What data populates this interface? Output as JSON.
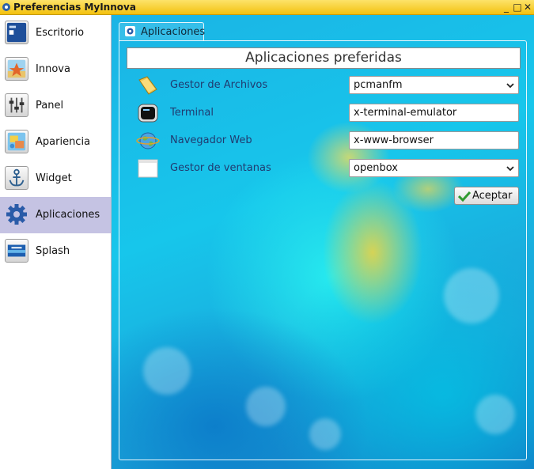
{
  "window": {
    "title": "Preferencias MyInnova",
    "controls": {
      "minimize": "_",
      "maximize": "□",
      "close": "✕"
    }
  },
  "sidebar": {
    "items": [
      {
        "label": "Escritorio",
        "icon": "desktop-icon"
      },
      {
        "label": "Innova",
        "icon": "innova-icon"
      },
      {
        "label": "Panel",
        "icon": "sliders-icon"
      },
      {
        "label": "Apariencia",
        "icon": "appearance-icon"
      },
      {
        "label": "Widget",
        "icon": "anchor-icon"
      },
      {
        "label": "Aplicaciones",
        "icon": "gear-icon",
        "selected": true
      },
      {
        "label": "Splash",
        "icon": "splash-icon"
      }
    ],
    "selected_color": "#c5c3e3"
  },
  "tab": {
    "label": "Aplicaciones",
    "icon": "gear-icon"
  },
  "main": {
    "header": "Aplicaciones preferidas",
    "rows": [
      {
        "label": "Gestor de Archivos",
        "control": "select",
        "value": "pcmanfm",
        "icon": "folder-icon"
      },
      {
        "label": "Terminal",
        "control": "input",
        "value": "x-terminal-emulator",
        "icon": "terminal-icon"
      },
      {
        "label": "Navegador Web",
        "control": "input",
        "value": "x-www-browser",
        "icon": "globe-icon"
      },
      {
        "label": "Gestor de ventanas",
        "control": "select",
        "value": "openbox",
        "icon": "window-icon"
      }
    ],
    "accept_label": "Aceptar"
  },
  "colors": {
    "titlebar": "#f3c10f",
    "background": "#17c6eb",
    "label_text": "#203b70"
  }
}
